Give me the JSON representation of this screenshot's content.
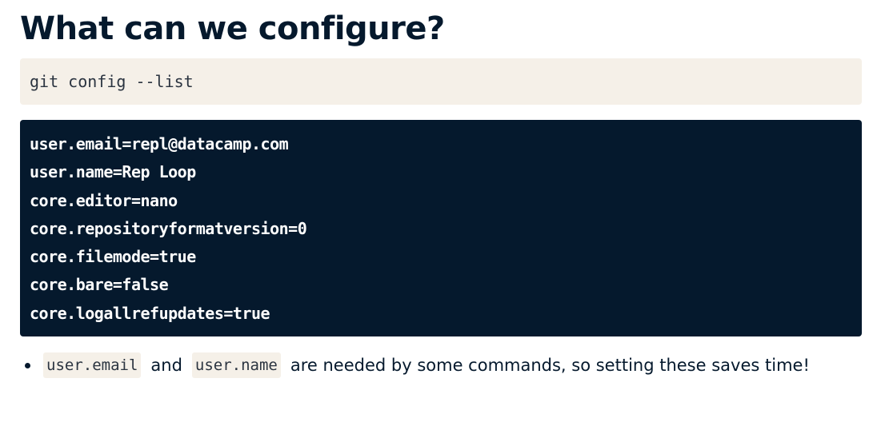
{
  "page": {
    "title": "What can we configure?"
  },
  "command": {
    "text": "git config --list"
  },
  "output": {
    "lines": [
      "user.email=repl@datacamp.com",
      "user.name=Rep Loop",
      "core.editor=nano",
      "core.repositoryformatversion=0",
      "core.filemode=true",
      "core.bare=false",
      "core.logallrefupdates=true"
    ]
  },
  "bullet": {
    "code_1": "user.email",
    "text_1": "and",
    "code_2": "user.name",
    "text_2": "are needed by some commands, so setting these saves time!"
  },
  "colors": {
    "title": "#05192d",
    "code_bg_light": "#f5f0e8",
    "code_bg_dark": "#05192d",
    "code_fg_dark": "#ffffff"
  }
}
